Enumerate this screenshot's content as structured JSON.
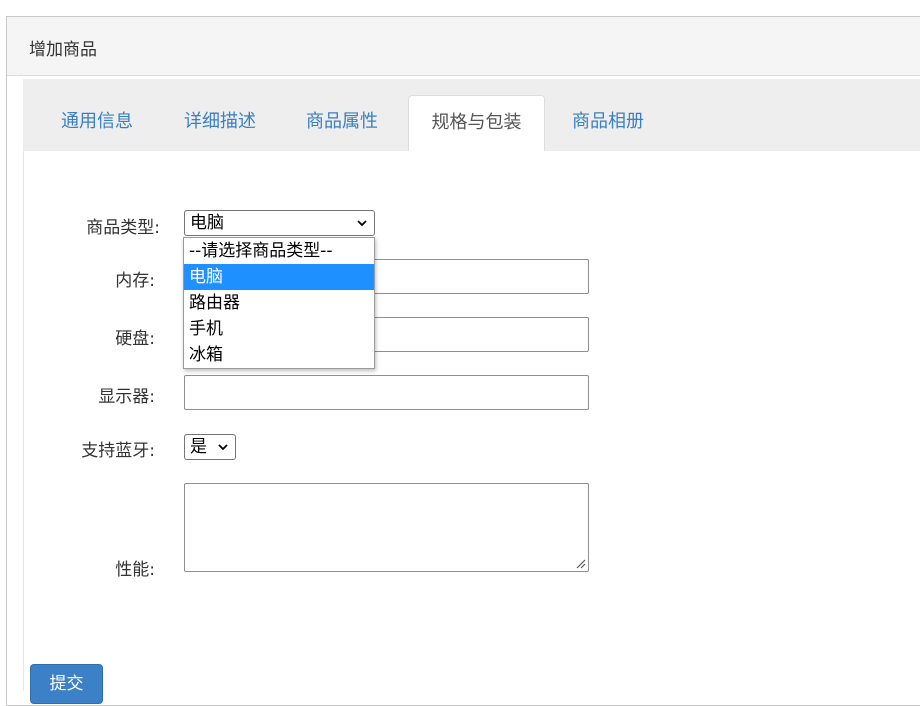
{
  "panel": {
    "title": "增加商品"
  },
  "tabs": [
    {
      "label": "通用信息",
      "active": false
    },
    {
      "label": "详细描述",
      "active": false
    },
    {
      "label": "商品属性",
      "active": false
    },
    {
      "label": "规格与包装",
      "active": true
    },
    {
      "label": "商品相册",
      "active": false
    }
  ],
  "form": {
    "goods_type": {
      "label": "商品类型:",
      "value": "电脑",
      "options": [
        "--请选择商品类型--",
        "电脑",
        "路由器",
        "手机",
        "冰箱"
      ],
      "highlighted_option": "电脑"
    },
    "memory": {
      "label": "内存:",
      "value": ""
    },
    "disk": {
      "label": "硬盘:",
      "value": ""
    },
    "display": {
      "label": "显示器:",
      "value": ""
    },
    "bluetooth": {
      "label": "支持蓝牙:",
      "value": "是"
    },
    "performance": {
      "label": "性能:",
      "value": ""
    },
    "submit_label": "提交"
  },
  "colors": {
    "tab_link": "#3a7fc1",
    "highlight": "#1e90ff",
    "primary_button": "#3c80c8"
  },
  "icons": {
    "select_arrow": "chevron-down-icon",
    "textarea_grip": "resize-grip-icon"
  }
}
